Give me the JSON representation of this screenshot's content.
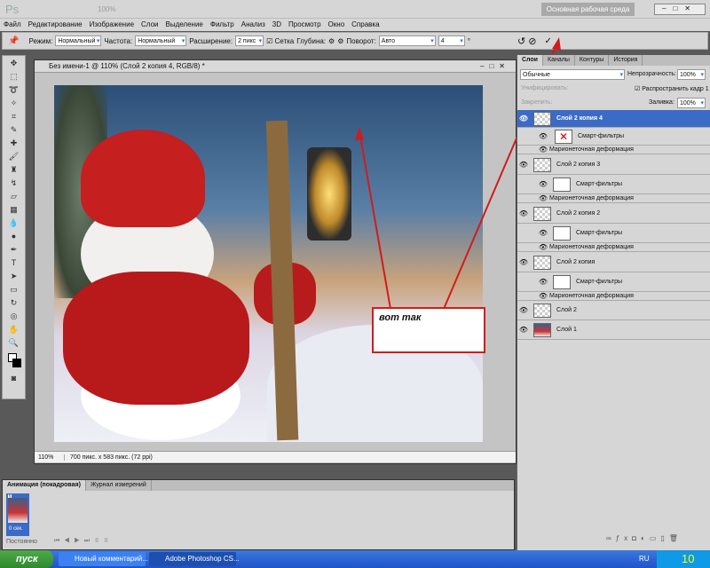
{
  "appbar": {
    "logo": "Ps",
    "zoom": "100%",
    "workspace": "Основная рабочая среда"
  },
  "menu": [
    "Файл",
    "Редактирование",
    "Изображение",
    "Слои",
    "Выделение",
    "Фильтр",
    "Анализ",
    "3D",
    "Просмотр",
    "Окно",
    "Справка"
  ],
  "options": {
    "mode_label": "Режим:",
    "mode": "Нормальный",
    "density_label": "Частота:",
    "density": "Нормальный",
    "expand_label": "Расширение:",
    "expand": "2 пикс",
    "grid_label": "Сетка",
    "depth_label": "Глубина:",
    "rotate_label": "Поворот:",
    "rotate": "Авто",
    "angle": "4",
    "degree": "°"
  },
  "document": {
    "title": "Без имени-1 @ 110% (Слой 2 копия 4, RGB/8) *",
    "zoom": "110%",
    "info": "700 пикс. x 583 пикс. (72 ppi)"
  },
  "annotation": {
    "text": "вот так",
    "color": "#d01c1c"
  },
  "layers_panel": {
    "tabs": [
      "Слои",
      "Каналы",
      "Контуры",
      "История"
    ],
    "blend": "Обычные",
    "opacity_label": "Непрозрачность:",
    "opacity": "100%",
    "unify_label": "Унифицировать:",
    "propagate_label": "Распространить кадр 1",
    "lock_label": "Закрепить:",
    "fill_label": "Заливка:",
    "fill": "100%",
    "layers": [
      {
        "name": "Слой 2 копия 4",
        "selected": true,
        "smart": "Смарт-фильтры",
        "filter": "Марионеточная деформация"
      },
      {
        "name": "Слой 2 копия 3",
        "smart": "Смарт-фильтры",
        "filter": "Марионеточная деформация"
      },
      {
        "name": "Слой 2 копия 2",
        "smart": "Смарт-фильтры",
        "filter": "Марионеточная деформация"
      },
      {
        "name": "Слой 2 копия",
        "smart": "Смарт-фильтры",
        "filter": "Марионеточная деформация"
      },
      {
        "name": "Слой 2"
      },
      {
        "name": "Слой 1"
      }
    ]
  },
  "animation_panel": {
    "tabs": [
      "Анимация (покадровая)",
      "Журнал измерений"
    ],
    "frame_number": "1",
    "frame_time": "0 сек.",
    "loop": "Постоянно"
  },
  "taskbar": {
    "start": "пуск",
    "tasks": [
      "Новый комментарий...",
      "Adobe Photoshop CS..."
    ],
    "lang": "RU",
    "clock": "10"
  }
}
